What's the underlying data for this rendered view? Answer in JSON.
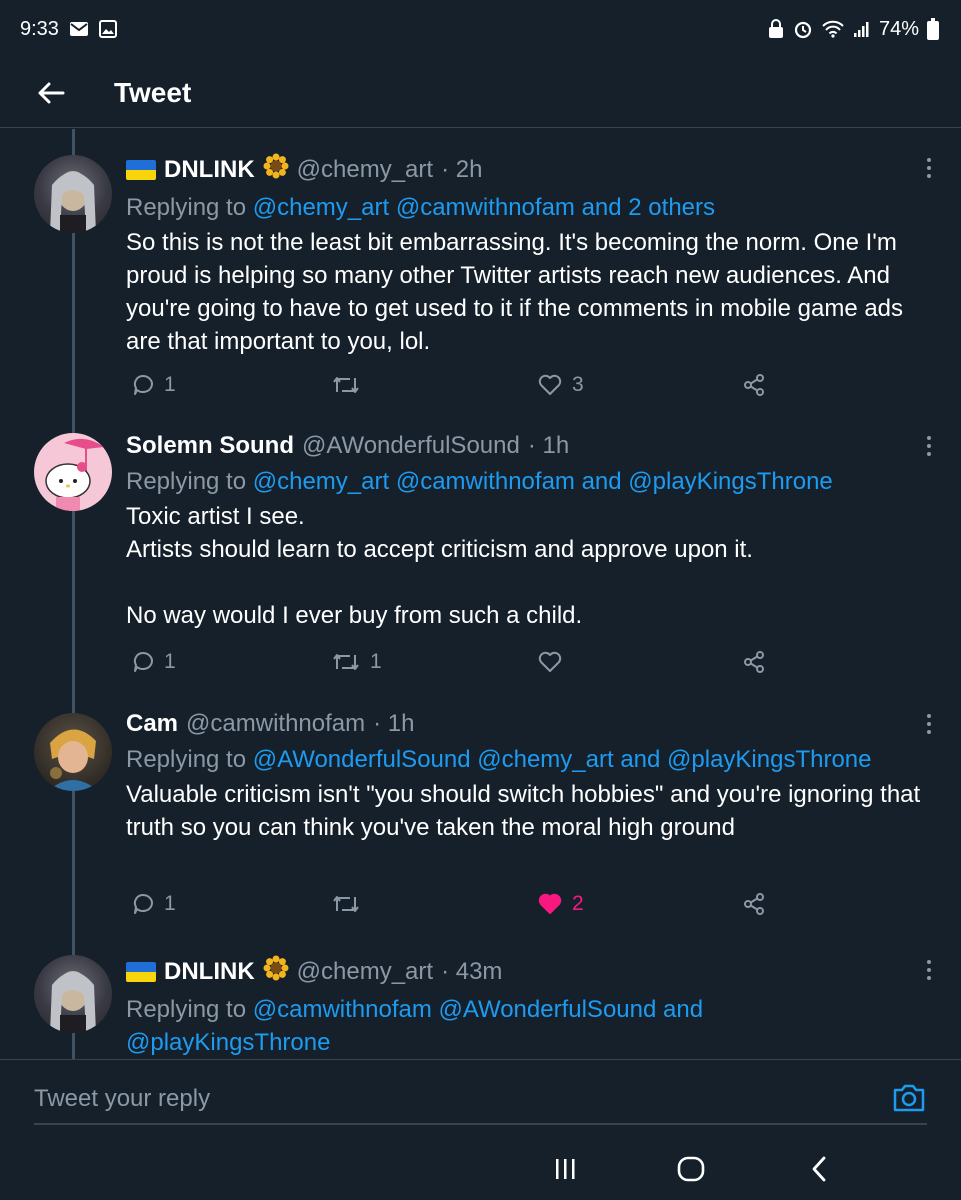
{
  "status_bar": {
    "time": "9:33",
    "battery": "74%"
  },
  "header": {
    "title": "Tweet"
  },
  "tweets": [
    {
      "name": "DNLINK",
      "handle": "@chemy_art",
      "time": "· 2h",
      "replying_to_label": "Replying to",
      "mentions": "@chemy_art @camwithnofam and 2 others",
      "text": "So this is not the least bit embarrassing. It's becoming the norm. One I'm proud is helping so many other Twitter artists reach new audiences. And you're going to have to get used to it if the comments in mobile game ads are that important to you, lol.",
      "reply_count": "1",
      "retweet_count": "",
      "like_count": "3"
    },
    {
      "name": "Solemn Sound",
      "handle": "@AWonderfulSound",
      "time": "· 1h",
      "replying_to_label": "Replying to",
      "mentions": "@chemy_art @camwithnofam and @playKingsThrone",
      "text": "Toxic artist I see.\nArtists should learn to accept criticism and approve upon it.\n\nNo way would I ever buy from such a child.",
      "reply_count": "1",
      "retweet_count": "1",
      "like_count": ""
    },
    {
      "name": "Cam",
      "handle": "@camwithnofam",
      "time": "· 1h",
      "replying_to_label": "Replying to",
      "mentions": "@AWonderfulSound @chemy_art and @playKingsThrone",
      "text": "Valuable criticism isn't \"you should switch hobbies\" and you're ignoring that truth so you can think you've taken the moral high ground",
      "reply_count": "1",
      "retweet_count": "",
      "like_count": "2"
    },
    {
      "name": "DNLINK",
      "handle": "@chemy_art",
      "time": "· 43m",
      "replying_to_label": "Replying to",
      "mentions_line1": "@camwithnofam @AWonderfulSound and",
      "mentions_line2": "@playKingsThrone"
    }
  ],
  "reply_box": {
    "placeholder": "Tweet your reply"
  },
  "colors": {
    "background": "#15202b",
    "accent": "#1d9bf0",
    "muted": "#8b98a5",
    "like": "#f91880"
  }
}
